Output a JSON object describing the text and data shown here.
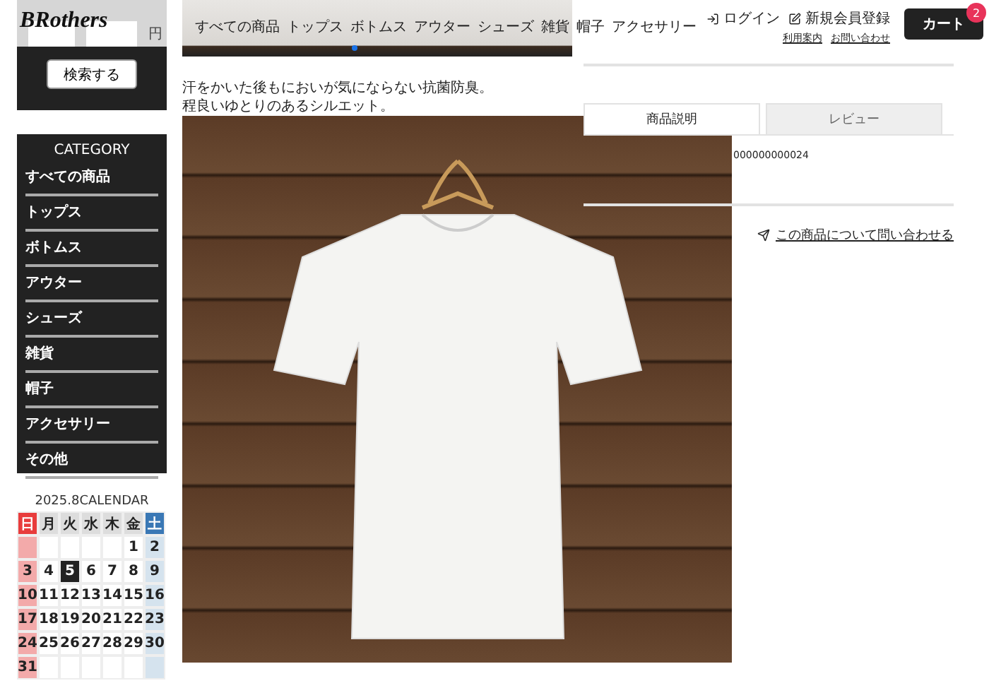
{
  "logo": "BRothers",
  "search": {
    "currency": "円",
    "button": "検索する"
  },
  "nav": [
    "すべての商品",
    "トップス",
    "ボトムス",
    "アウター",
    "シューズ",
    "雑貨",
    "帽子",
    "アクセサリー"
  ],
  "account": {
    "login": "ログイン",
    "register": "新規会員登録",
    "links": [
      "利用案内",
      "お問い合わせ"
    ]
  },
  "cart": {
    "label": "カート",
    "count": "2"
  },
  "category": {
    "title": "CATEGORY",
    "items": [
      "すべての商品",
      "トップス",
      "ボトムス",
      "アウター",
      "シューズ",
      "雑貨",
      "帽子",
      "アクセサリー",
      "その他"
    ]
  },
  "calendar": {
    "title": "2025.8CALENDAR",
    "weekdays": [
      {
        "label": "日",
        "kind": "sun"
      },
      {
        "label": "月",
        "kind": "day"
      },
      {
        "label": "火",
        "kind": "day"
      },
      {
        "label": "水",
        "kind": "day"
      },
      {
        "label": "木",
        "kind": "day"
      },
      {
        "label": "金",
        "kind": "day"
      },
      {
        "label": "土",
        "kind": "sat"
      }
    ],
    "weeks": [
      {
        "days": [
          {
            "label": "1",
            "selected": false
          },
          {
            "label": "2",
            "selected": false
          }
        ]
      },
      {
        "days": [
          {
            "label": "3",
            "selected": false
          },
          {
            "label": "4",
            "selected": false
          },
          {
            "label": "5",
            "selected": true
          },
          {
            "label": "6",
            "selected": false
          },
          {
            "label": "7",
            "selected": false
          },
          {
            "label": "8",
            "selected": false
          },
          {
            "label": "9",
            "selected": false
          }
        ]
      },
      {
        "days": [
          {
            "label": "10",
            "selected": false
          },
          {
            "label": "11",
            "selected": false
          },
          {
            "label": "12",
            "selected": false
          },
          {
            "label": "13",
            "selected": false
          },
          {
            "label": "14",
            "selected": false
          },
          {
            "label": "15",
            "selected": false
          },
          {
            "label": "16",
            "selected": false
          }
        ]
      },
      {
        "days": [
          {
            "label": "17",
            "selected": false
          },
          {
            "label": "18",
            "selected": false
          },
          {
            "label": "19",
            "selected": false
          },
          {
            "label": "20",
            "selected": false
          },
          {
            "label": "21",
            "selected": false
          },
          {
            "label": "22",
            "selected": false
          },
          {
            "label": "23",
            "selected": false
          }
        ]
      },
      {
        "days": [
          {
            "label": "24",
            "selected": false
          },
          {
            "label": "25",
            "selected": false
          },
          {
            "label": "26",
            "selected": false
          },
          {
            "label": "27",
            "selected": false
          },
          {
            "label": "28",
            "selected": false
          },
          {
            "label": "29",
            "selected": false
          },
          {
            "label": "30",
            "selected": false
          }
        ]
      },
      {
        "days": [
          {
            "label": "31",
            "selected": false
          }
        ]
      }
    ]
  },
  "product": {
    "description": [
      "汗をかいた後もにおいが気にならない抗菌防臭。",
      "程良いゆとりのあるシルエット。"
    ]
  },
  "tabs": [
    {
      "label": "商品説明",
      "selected": true
    },
    {
      "label": "レビュー",
      "selected": false
    }
  ],
  "product_code": "000000000024",
  "inquiry_link": "この商品について問い合わせる"
}
